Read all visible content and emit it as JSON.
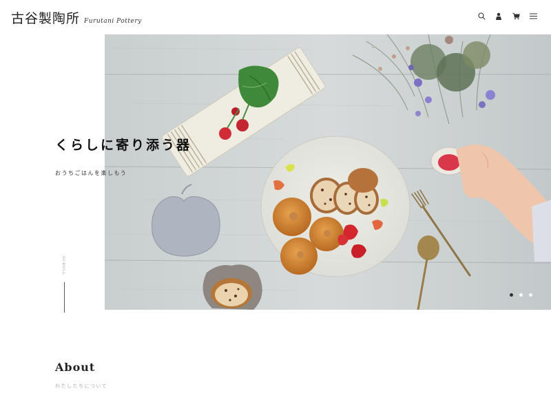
{
  "header": {
    "logo_jp": "古谷製陶所",
    "logo_en": "Furutani Pottery",
    "icons": [
      "search-icon",
      "user-icon",
      "cart-icon",
      "menu-icon"
    ]
  },
  "hero": {
    "title": "くらしに寄り添う器",
    "subtitle": "おうちごはんを楽しもう",
    "scroll_label": "SCROLL",
    "slides": 3,
    "active_slide": 1
  },
  "about": {
    "title": "About",
    "subtitle": "わたしたちについて"
  },
  "colors": {
    "text": "#222222",
    "accent_dot": "#333333",
    "muted": "#aaaaaa"
  }
}
